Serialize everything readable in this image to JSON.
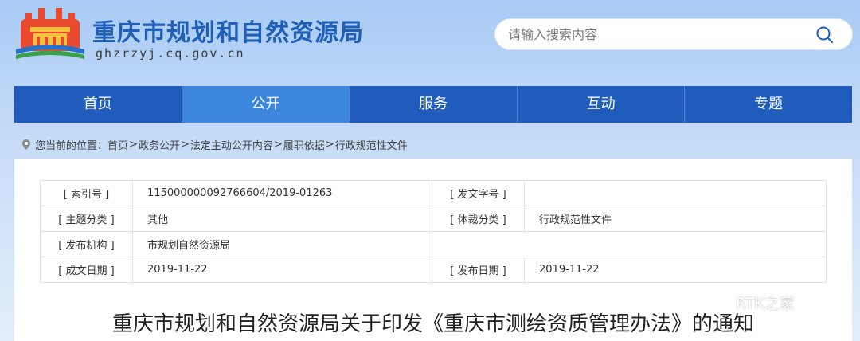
{
  "header": {
    "site_title": "重庆市规划和自然资源局",
    "domain": "ghzrzyj.cq.gov.cn"
  },
  "search": {
    "placeholder": "请输入搜索内容",
    "icon": "search-icon"
  },
  "nav": {
    "items": [
      "首页",
      "公开",
      "服务",
      "互动",
      "专题"
    ],
    "active": "公开"
  },
  "breadcrumb": {
    "prefix": "您当前的位置：",
    "items": [
      "首页",
      "政务公开",
      "法定主动公开内容",
      "履职依据",
      "行政规范性文件"
    ],
    "separator": ">"
  },
  "meta": {
    "index_label": "[ 索引号 ]",
    "index_value": "115000000092766604/2019-01263",
    "docno_label": "[ 发文字号 ]",
    "docno_value": "",
    "topic_label": "[ 主题分类 ]",
    "topic_value": "其他",
    "genre_label": "[ 体裁分类 ]",
    "genre_value": "行政规范性文件",
    "org_label": "[ 发布机构 ]",
    "org_value": "市规划自然资源局",
    "created_label": "[ 成文日期 ]",
    "created_value": "2019-11-22",
    "published_label": "[ 发布日期 ]",
    "published_value": "2019-11-22"
  },
  "document": {
    "title": "重庆市规划和自然资源局关于印发《重庆市测绘资质管理办法》的通知"
  },
  "watermark": {
    "text": "RTK之家"
  },
  "colors": {
    "nav_bg": "#1f5cbb",
    "nav_active": "#3c87dd",
    "title_blue": "#1f5fb8"
  }
}
